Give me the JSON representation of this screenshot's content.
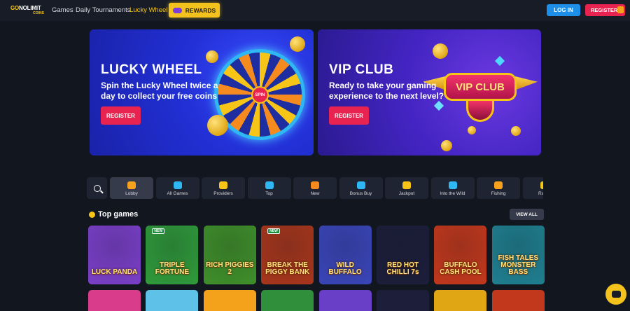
{
  "header": {
    "logo_main": "GO",
    "logo_accent": "NOLIMIT",
    "logo_sub": "COINS",
    "nav": [
      "Games",
      "Daily Tournaments",
      "Lucky Wheel"
    ],
    "rewards_label": "REWARDS",
    "login_label": "LOG IN",
    "register_label": "REGISTER"
  },
  "banners": {
    "lucky": {
      "title": "LUCKY WHEEL",
      "text": "Spin the Lucky Wheel twice a day to collect your free coins",
      "button": "REGISTER",
      "wheel_center": "SPIN"
    },
    "vip": {
      "title": "VIP CLUB",
      "text": "Ready to take your gaming experience to the next level?",
      "button": "REGISTER",
      "badge": "VIP CLUB"
    }
  },
  "categories": [
    {
      "label": "Lobby",
      "icon": "lobby-icon",
      "color": "#f7a21c"
    },
    {
      "label": "All Games",
      "icon": "all-games-icon",
      "color": "#2fb7f4"
    },
    {
      "label": "Providers",
      "icon": "providers-icon",
      "color": "#f7c518"
    },
    {
      "label": "Top",
      "icon": "top-icon",
      "color": "#2fb7f4"
    },
    {
      "label": "New",
      "icon": "new-icon",
      "color": "#f58a1f"
    },
    {
      "label": "Bonus Buy",
      "icon": "bonus-buy-icon",
      "color": "#2fb7f4"
    },
    {
      "label": "Jackpot",
      "icon": "jackpot-icon",
      "color": "#f7c518"
    },
    {
      "label": "Into the Wild",
      "icon": "into-the-wild-icon",
      "color": "#2fb7f4"
    },
    {
      "label": "Fishing",
      "icon": "fishing-icon",
      "color": "#f7a21c"
    },
    {
      "label": "Rapid",
      "icon": "rapid-icon",
      "color": "#f7c518"
    }
  ],
  "top_games": {
    "title": "Top games",
    "view_all": "VIEW ALL",
    "new_badge": "NEW",
    "games": [
      {
        "title": "LUCK PANDA",
        "badge": "",
        "bg": "#7a3fc8"
      },
      {
        "title": "TRIPLE FORTUNE",
        "badge": "NEW",
        "bg": "#2f9a3a"
      },
      {
        "title": "RICH PIGGIES 2",
        "badge": "",
        "bg": "#3f8f2a"
      },
      {
        "title": "BREAK THE PIGGY BANK",
        "badge": "NEW",
        "bg": "#a8361c"
      },
      {
        "title": "WILD BUFFALO",
        "badge": "",
        "bg": "#3a45b8"
      },
      {
        "title": "RED HOT CHILLI 7s",
        "badge": "",
        "bg": "#1c1e3a"
      },
      {
        "title": "BUFFALO CASH POOL",
        "badge": "",
        "bg": "#c2381c"
      },
      {
        "title": "FISH TALES MONSTER BASS",
        "badge": "",
        "bg": "#1f7f8f"
      }
    ],
    "second_row_colors": [
      "#d93c8a",
      "#5ec2e8",
      "#f4a21c",
      "#2f8f3a",
      "#6a3fc8",
      "#1c1e3a",
      "#e0a614",
      "#c2381c"
    ]
  }
}
